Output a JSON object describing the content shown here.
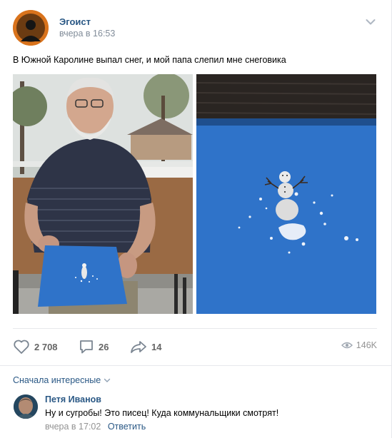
{
  "post": {
    "author": "Эгоист",
    "time": "вчера в 16:53",
    "text": "В Южной Каролине выпал снег, и мой папа слепил мне снеговика"
  },
  "actions": {
    "likes": "2 708",
    "comments": "26",
    "shares": "14",
    "views": "146K"
  },
  "comments_section": {
    "sort_label": "Сначала интересные",
    "items": [
      {
        "author": "Петя Иванов",
        "text": "Ну и сугробы! Это писец! Куда коммунальщики смотрят!",
        "time": "вчера в 17:02",
        "reply_label": "Ответить"
      }
    ]
  },
  "icons": {
    "menu": "chevron-down-icon",
    "like": "heart-icon",
    "comment": "speech-bubble-icon",
    "share": "share-arrow-icon",
    "views": "eye-icon",
    "sort": "small-chevron-down-icon"
  },
  "colors": {
    "link": "#2a5885",
    "secondary": "#818c99",
    "action": "#656565",
    "separator": "#e7e8ec",
    "blue_board": "#2f73c9"
  }
}
